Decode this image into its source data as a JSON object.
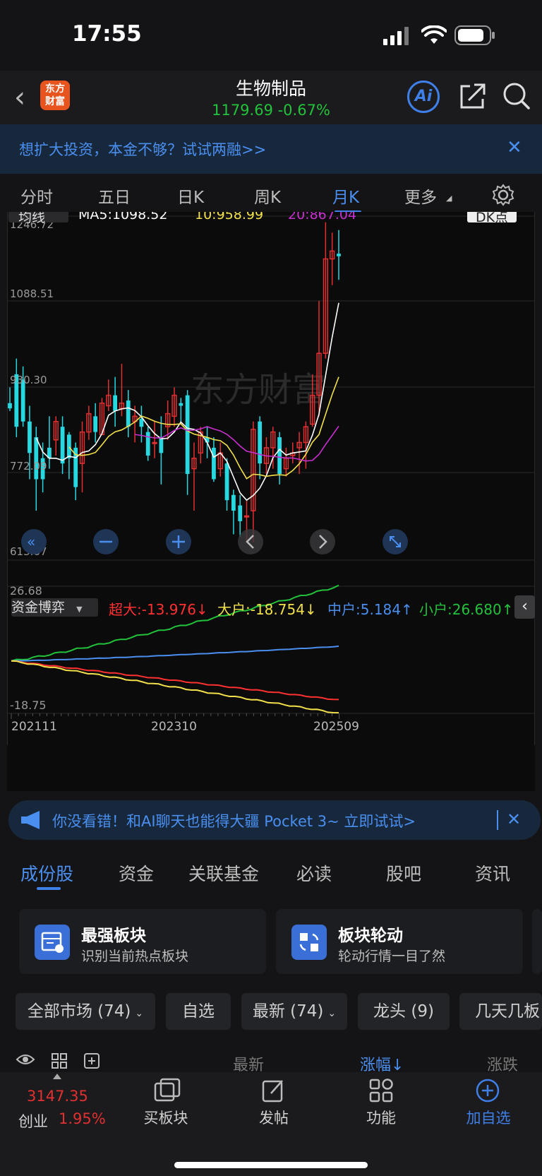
{
  "status_bar": {
    "time": "17:55"
  },
  "header": {
    "logo": "东方\n财富",
    "logo_line1": "东方",
    "logo_line2": "财富",
    "title": "生物制品",
    "price_line": "1179.69  -0.67%",
    "ai_label": "Ai"
  },
  "banner": {
    "text": "想扩大投资，本金不够？试试两融>>"
  },
  "tabs": [
    "分时",
    "五日",
    "日K",
    "周K",
    "月K",
    "更多"
  ],
  "active_tab": "月K",
  "kline": {
    "ma_selector": "均线",
    "ma5": "MA5:1098.52",
    "ma10": "10:958.99",
    "ma20": "20:867.04",
    "right_badge": "DK点",
    "y_ticks": [
      "1246.72",
      "1088.51",
      "930.30",
      "772.09",
      "613.87"
    ],
    "watermark": "东方财富"
  },
  "funds": {
    "selector": "资金博弈",
    "chaoda": "超大:-13.976↓",
    "dahu": "大户:-18.754↓",
    "zhonghu": "中户:5.184↑",
    "xiaohu": "小户:26.680↑",
    "y_max": "26.68",
    "y_min": "-18.75",
    "x_ticks": [
      "202111",
      "202310",
      "202509"
    ]
  },
  "colors": {
    "up": "#e23030",
    "down": "#27d8e0",
    "ma5": "#ffffff",
    "ma10": "#f2e04a",
    "ma20": "#c92fcf",
    "accent": "#3f7fe8",
    "green": "#22c23a"
  },
  "ad": {
    "text": "你没看错！和AI聊天也能得大疆 Pocket 3~ 立即试试>"
  },
  "section_tabs": [
    "成份股",
    "资金",
    "关联基金",
    "必读",
    "股吧",
    "资讯"
  ],
  "cards": [
    {
      "title": "最强板块",
      "sub": "识别当前热点板块"
    },
    {
      "title": "板块轮动",
      "sub": "轮动行情一目了然"
    }
  ],
  "chips": [
    "全部市场 (74)",
    "自选",
    "最新 (74)",
    "龙头 (9)",
    "几天几板"
  ],
  "table_header": {
    "latest": "最新",
    "change": "涨幅↓",
    "delta": "涨跌"
  },
  "bottom_bar": {
    "index_value": "3147.35",
    "index_name": "创业",
    "index_change": "1.95%",
    "items": [
      "买板块",
      "发帖",
      "功能",
      "加自选"
    ]
  }
}
